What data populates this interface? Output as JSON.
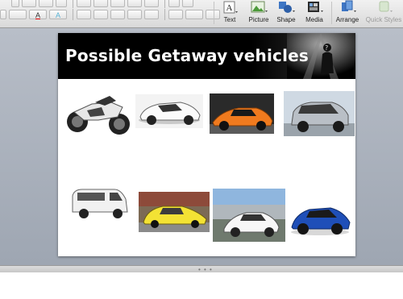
{
  "ribbon": {
    "tools": [
      {
        "id": "text",
        "label": "Text"
      },
      {
        "id": "picture",
        "label": "Picture"
      },
      {
        "id": "shape",
        "label": "Shape"
      },
      {
        "id": "media",
        "label": "Media"
      },
      {
        "id": "arrange",
        "label": "Arrange"
      },
      {
        "id": "quick_styles",
        "label": "Quick Styles"
      }
    ]
  },
  "slide": {
    "title": "Possible Getaway vehicles",
    "images": [
      {
        "name": "motorcycle-photo",
        "icon": "motorcycle"
      },
      {
        "name": "white-sports-car-photo",
        "icon": "sports-car"
      },
      {
        "name": "orange-supercar-photo",
        "icon": "supercar"
      },
      {
        "name": "silver-suv-photo",
        "icon": "suv"
      },
      {
        "name": "white-van-photo",
        "icon": "van"
      },
      {
        "name": "yellow-three-wheeler-photo",
        "icon": "three-wheeler"
      },
      {
        "name": "white-hybrid-car-photo",
        "icon": "hybrid-car"
      },
      {
        "name": "blue-hatchback-photo",
        "icon": "hatchback"
      }
    ]
  },
  "colors": {
    "ribbon_bg": "#e4e4e4",
    "stage_bg": "#a9b0bb",
    "banner_bg": "#000000",
    "title_text": "#ffffff"
  }
}
